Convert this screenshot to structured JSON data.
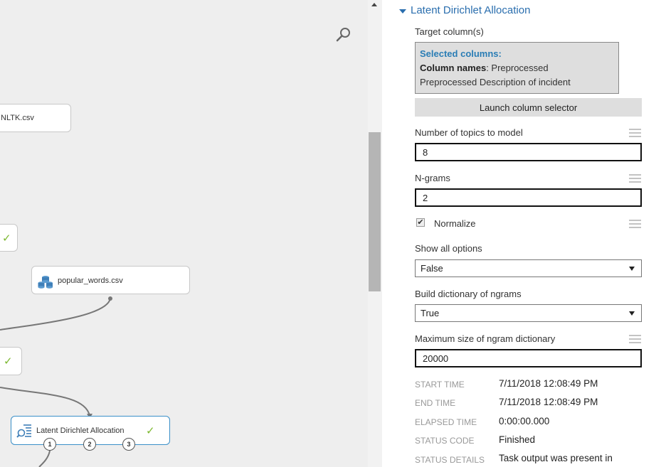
{
  "canvas": {
    "nodes": {
      "nltk": {
        "label": "NLTK.csv"
      },
      "popular_words": {
        "label": "popular_words.csv"
      },
      "lda": {
        "label": "Latent Dirichlet Allocation",
        "ports": [
          "1",
          "2",
          "3"
        ]
      }
    },
    "check_glyph": "✓"
  },
  "panel": {
    "title": "Latent Dirichlet Allocation",
    "target_columns": {
      "label": "Target column(s)",
      "selected_heading": "Selected columns:",
      "names_key": "Column names",
      "names_value": ": Preprocessed",
      "names_value2": "Preprocessed Description of incident"
    },
    "launch_button": "Launch column selector",
    "num_topics": {
      "label": "Number of topics to model",
      "value": "8"
    },
    "ngrams": {
      "label": "N-grams",
      "value": "2"
    },
    "normalize": {
      "label": "Normalize",
      "checked": true,
      "glyph": "✔"
    },
    "show_all_options": {
      "label": "Show all options",
      "value": "False"
    },
    "build_dictionary": {
      "label": "Build dictionary of ngrams",
      "value": "True"
    },
    "max_dict_size": {
      "label": "Maximum size of ngram dictionary",
      "value": "20000"
    },
    "meta": [
      {
        "key": "START TIME",
        "value": "7/11/2018 12:08:49 PM"
      },
      {
        "key": "END TIME",
        "value": "7/11/2018 12:08:49 PM"
      },
      {
        "key": "ELAPSED TIME",
        "value": "0:00:00.000"
      },
      {
        "key": "STATUS CODE",
        "value": "Finished"
      },
      {
        "key": "STATUS DETAILS",
        "value": "Task output was present in"
      }
    ]
  },
  "colors": {
    "accent": "#2a6eae",
    "selected": "#2a7db5",
    "success": "#7cb82f",
    "node_border_active": "#3a8fc8"
  }
}
